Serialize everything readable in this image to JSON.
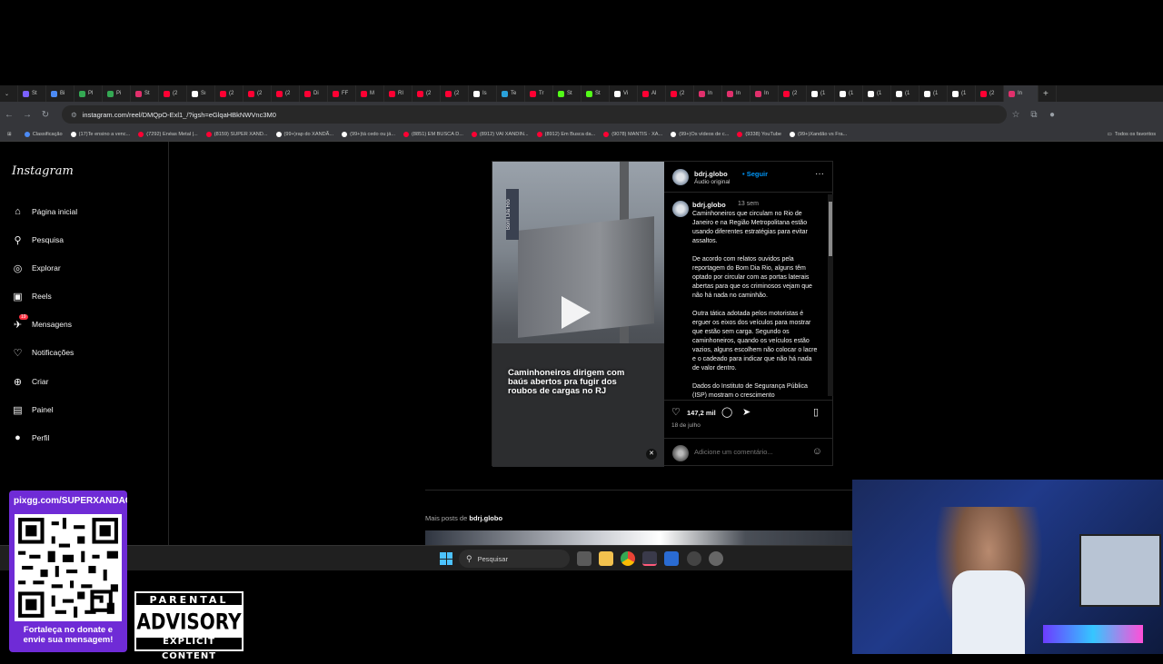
{
  "browser": {
    "tabs": [
      {
        "label": "St",
        "color": "#7b61ff"
      },
      {
        "label": "Bi",
        "color": "#4c8bf5"
      },
      {
        "label": "Pl",
        "color": "#34a853"
      },
      {
        "label": "Pi",
        "color": "#34a853"
      },
      {
        "label": "St",
        "color": "#e1306c"
      },
      {
        "label": "(2",
        "color": "#ff0033"
      },
      {
        "label": "Sı",
        "color": "#ffffff"
      },
      {
        "label": "(2",
        "color": "#ff0033"
      },
      {
        "label": "(2",
        "color": "#ff0033"
      },
      {
        "label": "(2",
        "color": "#ff0033"
      },
      {
        "label": "Di",
        "color": "#ff0033"
      },
      {
        "label": "FF",
        "color": "#ff0033"
      },
      {
        "label": "M",
        "color": "#ff0033"
      },
      {
        "label": "RI",
        "color": "#ff0033"
      },
      {
        "label": "(2",
        "color": "#ff0033"
      },
      {
        "label": "(2",
        "color": "#ff0033"
      },
      {
        "label": "Is",
        "color": "#ffffff"
      },
      {
        "label": "Te",
        "color": "#2aa1da"
      },
      {
        "label": "Tr",
        "color": "#ff0033"
      },
      {
        "label": "St",
        "color": "#53fc18"
      },
      {
        "label": "St",
        "color": "#53fc18"
      },
      {
        "label": "Vi",
        "color": "#ffffff"
      },
      {
        "label": "Al",
        "color": "#ff0033"
      },
      {
        "label": "(2",
        "color": "#ff0033"
      },
      {
        "label": "In",
        "color": "#e1306c"
      },
      {
        "label": "In",
        "color": "#e1306c"
      },
      {
        "label": "In",
        "color": "#e1306c"
      },
      {
        "label": "(2",
        "color": "#ff0033"
      },
      {
        "label": "(1",
        "color": "#ffffff"
      },
      {
        "label": "(1",
        "color": "#ffffff"
      },
      {
        "label": "(1",
        "color": "#ffffff"
      },
      {
        "label": "(1",
        "color": "#ffffff"
      },
      {
        "label": "(1",
        "color": "#ffffff"
      },
      {
        "label": "(1",
        "color": "#ffffff"
      },
      {
        "label": "(2",
        "color": "#ff0033"
      },
      {
        "label": "In",
        "color": "#e1306c"
      }
    ],
    "url": "instagram.com/reel/DMQpO-Exl1_/?igsh=eGlqaHBkNWVnc3M0",
    "bookmarks": [
      {
        "label": "Classificação",
        "color": "#4c8bf5"
      },
      {
        "label": "(17)Te ensino a venc...",
        "color": "#ffffff"
      },
      {
        "label": "(7292) Enéas Metal |...",
        "color": "#ff0033"
      },
      {
        "label": "(8159) SUPER XAND...",
        "color": "#ff0033"
      },
      {
        "label": "(99+)rap do XANDÃ...",
        "color": "#ffffff"
      },
      {
        "label": "(99+)tá cedo ou já...",
        "color": "#ffffff"
      },
      {
        "label": "(8851) EM BUSCA D...",
        "color": "#ff0033"
      },
      {
        "label": "(8912) VAI XANDIN...",
        "color": "#ff0033"
      },
      {
        "label": "(8912) Em Busca da...",
        "color": "#ff0033"
      },
      {
        "label": "(9078) MANTIS · XA...",
        "color": "#ff0033"
      },
      {
        "label": "(99+)Os vídeos de c...",
        "color": "#ffffff"
      },
      {
        "label": "(9338) YouTube",
        "color": "#ff0033"
      },
      {
        "label": "(99+)Xandão vs Fra...",
        "color": "#ffffff"
      }
    ],
    "all_bookmarks": "Todos os favoritos"
  },
  "instagram": {
    "logo": "Instagram",
    "nav": [
      {
        "label": "Página inicial",
        "icon": "home-icon",
        "glyph": "⌂"
      },
      {
        "label": "Pesquisa",
        "icon": "search-icon",
        "glyph": "⚲"
      },
      {
        "label": "Explorar",
        "icon": "compass-icon",
        "glyph": "◎"
      },
      {
        "label": "Reels",
        "icon": "reels-icon",
        "glyph": "▣"
      },
      {
        "label": "Mensagens",
        "icon": "messenger-icon",
        "glyph": "✈"
      },
      {
        "label": "Notificações",
        "icon": "heart-icon",
        "glyph": "♡"
      },
      {
        "label": "Criar",
        "icon": "plus-icon",
        "glyph": "⊕"
      },
      {
        "label": "Painel",
        "icon": "dashboard-icon",
        "glyph": "▤"
      },
      {
        "label": "Perfil",
        "icon": "profile-icon",
        "glyph": "●"
      }
    ],
    "messages_badge": "19",
    "post": {
      "username": "bdrj.globo",
      "follow": "Seguir",
      "audio": "Áudio original",
      "video_caption": "Caminhoneiros dirigem com baús abertos pra fugir dos roubos de cargas no RJ",
      "video_brand": "Bom Dia Rio",
      "comment_user": "bdrj.globo",
      "comment_time": "13 sem",
      "caption": "Caminhoneiros que circulam no Rio de Janeiro e na Região Metropolitana estão usando diferentes estratégias para evitar assaltos.\n\nDe acordo com relatos ouvidos pela reportagem do Bom Dia Rio, alguns têm optado por circular com as portas laterais abertas para que os criminosos vejam que não há nada no caminhão.\n\nOutra tática adotada pelos motoristas é erguer os eixos dos veículos para mostrar que estão sem carga. Segundo os caminhoneiros, quando os veículos estão vazios, alguns escolhem não colocar o lacre e o cadeado para indicar que não há nada de valor dentro.\n\nDados do Instituto de Segurança Pública (ISP) mostram o crescimento",
      "likes": "147,2 mil",
      "date": "18 de julho",
      "comment_placeholder": "Adicione um comentário..."
    },
    "more_posts_prefix": "Mais posts de",
    "more_posts_user": "bdrj.globo"
  },
  "taskbar": {
    "search_placeholder": "Pesquisar"
  },
  "overlay": {
    "qr_url": "pixgg.com/SUPERXANDAO",
    "qr_text": "Fortaleça no donate e envie sua mensagem!",
    "advisory_top": "PARENTAL",
    "advisory_mid": "ADVISORY",
    "advisory_bot": "EXPLICIT CONTENT"
  }
}
